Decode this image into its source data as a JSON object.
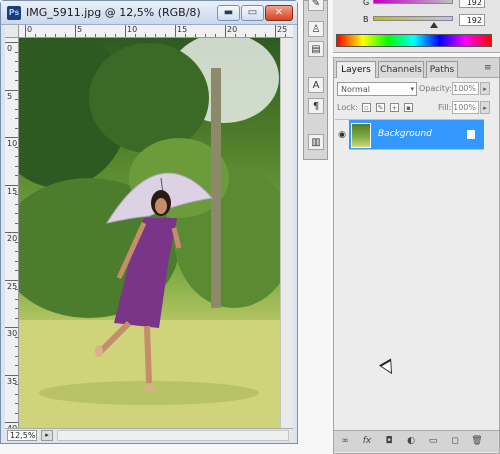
{
  "document": {
    "app_icon": "Ps",
    "title": "IMG_5911.jpg @ 12,5% (RGB/8)",
    "buttons": {
      "minimize": "▬",
      "maximize": "▭",
      "close": "✕"
    },
    "ruler_h_labels": [
      "0",
      "5",
      "10",
      "15",
      "20",
      "25"
    ],
    "ruler_v_labels": [
      "0",
      "5",
      "10",
      "15",
      "20",
      "25",
      "30",
      "35",
      "40"
    ],
    "zoom_label": "12,5%"
  },
  "color_panel": {
    "sliders": [
      {
        "label": "G",
        "value": "192"
      },
      {
        "label": "B",
        "value": "192"
      }
    ]
  },
  "tools_icons": [
    "smudge-tool-icon",
    "clone-stamp-icon",
    "history-brush-icon",
    "character-icon",
    "paragraph-icon",
    "layer-comps-icon"
  ],
  "layers_panel": {
    "tabs": [
      {
        "label": "Layers ×"
      },
      {
        "label": "Channels"
      },
      {
        "label": "Paths"
      }
    ],
    "blend_mode": "Normal",
    "opacity_label": "Opacity:",
    "opacity_value": "100%",
    "lock_label": "Lock:",
    "fill_label": "Fill:",
    "fill_value": "100%",
    "layer": {
      "name": "Background",
      "selected_color": "#3399ff"
    },
    "bottom_icons": [
      "link-icon",
      "fx-icon",
      "mask-icon",
      "adjustment-icon",
      "group-icon",
      "new-layer-icon",
      "trash-icon"
    ]
  }
}
